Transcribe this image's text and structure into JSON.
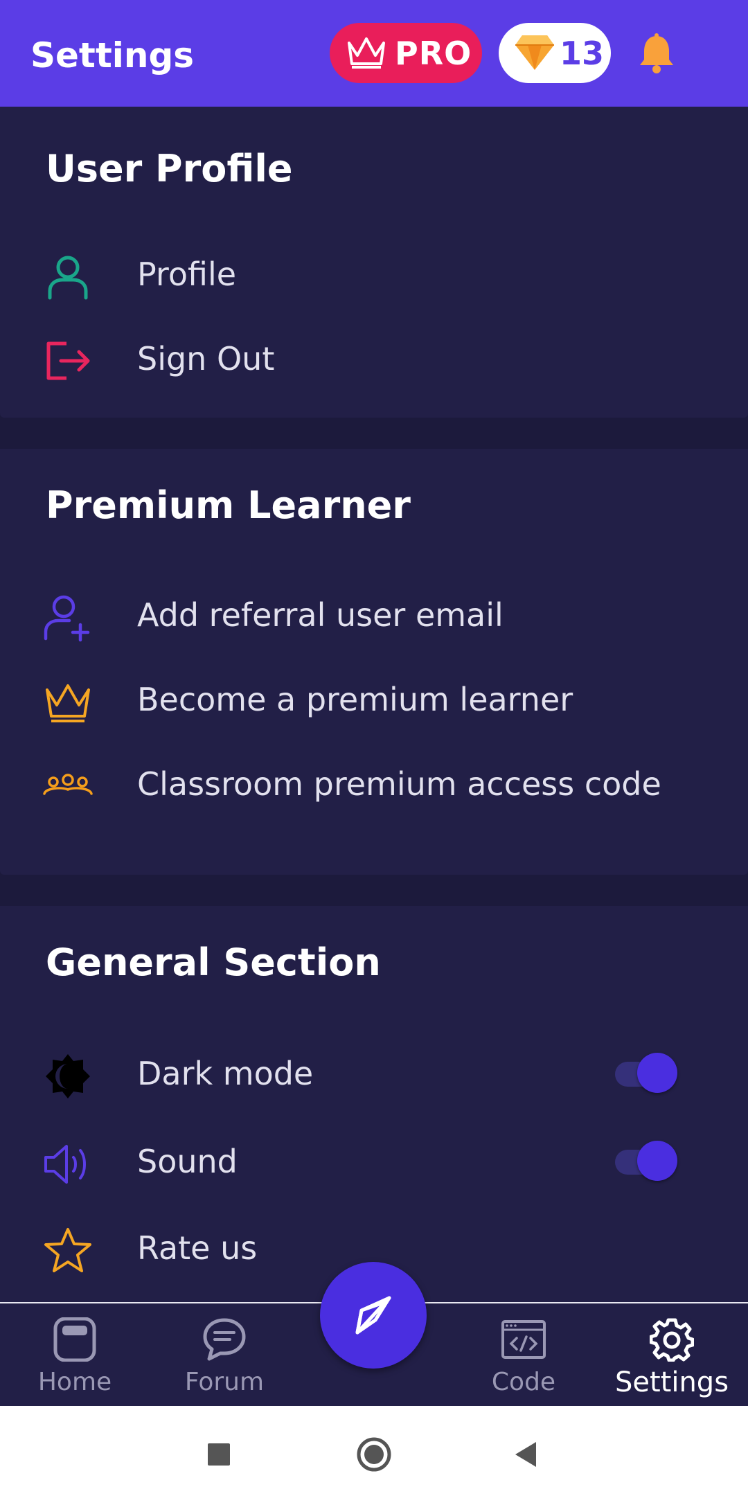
{
  "header": {
    "title": "Settings",
    "pro_label": "PRO",
    "gem_count": "13",
    "icons": [
      "crown-icon",
      "gem-icon",
      "bell-icon"
    ]
  },
  "sections": [
    {
      "title": "User Profile",
      "items": [
        {
          "label": "Profile",
          "icon": "user-icon",
          "color": "#1aa68a"
        },
        {
          "label": "Sign Out",
          "icon": "sign-out-icon",
          "color": "#e8265e"
        }
      ]
    },
    {
      "title": "Premium Learner",
      "items": [
        {
          "label": "Add referral user email",
          "icon": "user-add-icon",
          "color": "#5b3de6"
        },
        {
          "label": "Become a premium learner",
          "icon": "crown-icon",
          "color": "#f5a623"
        },
        {
          "label": "Classroom premium access code",
          "icon": "group-icon",
          "color": "#f59e1b"
        }
      ]
    },
    {
      "title": "General Section",
      "items": [
        {
          "label": "Dark mode",
          "icon": "dark-mode-icon",
          "toggle": true,
          "on": true
        },
        {
          "label": "Sound",
          "icon": "sound-icon",
          "color": "#5b3de6",
          "toggle": true,
          "on": true
        },
        {
          "label": "Rate us",
          "icon": "star-icon",
          "color": "#f5a623"
        }
      ]
    }
  ],
  "bottom_nav": {
    "items": [
      {
        "label": "Home",
        "icon": "home-icon",
        "active": false
      },
      {
        "label": "Forum",
        "icon": "forum-icon",
        "active": false
      },
      {
        "label": "Code",
        "icon": "code-icon",
        "active": false
      },
      {
        "label": "Settings",
        "icon": "gear-icon",
        "active": true
      }
    ],
    "fab_icon": "compass-icon"
  },
  "colors": {
    "header_bg": "#5b3de6",
    "card_bg": "#221f47",
    "page_bg": "#1c1a3c",
    "pro_bg": "#e91e5a",
    "toggle_knob": "#4a2ee0"
  }
}
